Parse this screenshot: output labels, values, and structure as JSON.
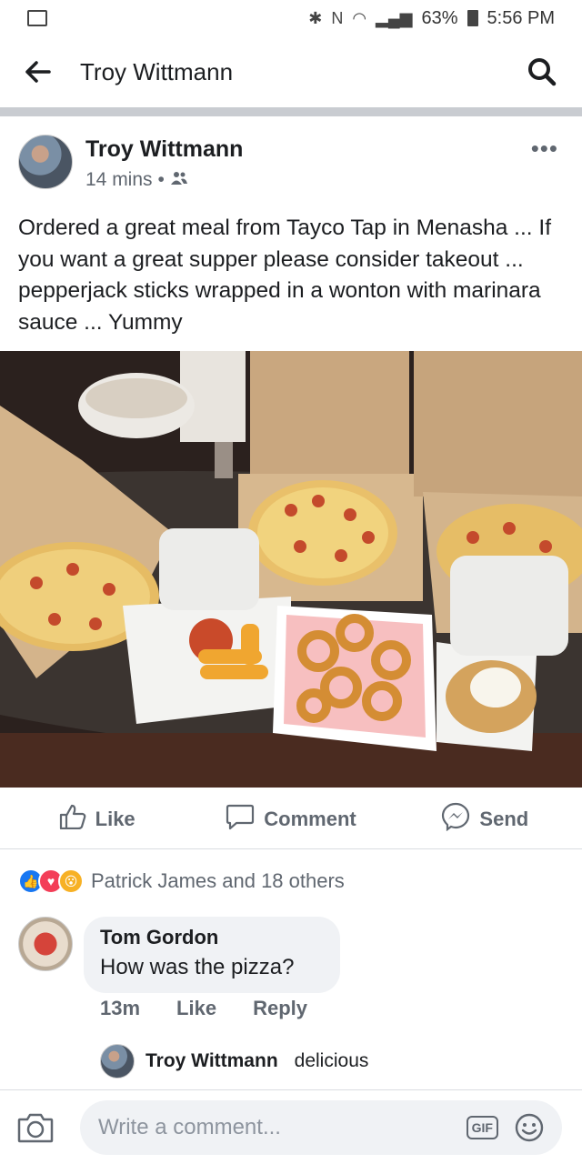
{
  "status_bar": {
    "battery": "63%",
    "time": "5:56 PM"
  },
  "header": {
    "title": "Troy Wittmann"
  },
  "post": {
    "author": "Troy Wittmann",
    "time": "14 mins",
    "text": "Ordered a great meal from Tayco Tap in Menasha ... If you want a great supper please consider takeout ... pepperjack sticks wrapped in a wonton with marinara sauce ... Yummy"
  },
  "actions": {
    "like": "Like",
    "comment": "Comment",
    "send": "Send"
  },
  "reactions": {
    "text": "Patrick James and 18 others"
  },
  "comment": {
    "author": "Tom Gordon",
    "text": "How was the pizza?",
    "time": "13m",
    "like": "Like",
    "reply": "Reply"
  },
  "reply": {
    "author": "Troy Wittmann",
    "text": "delicious"
  },
  "composer": {
    "placeholder": "Write a comment...",
    "gif": "GIF"
  },
  "colors": {
    "brand_blue": "#1877f2",
    "text": "#1c1e21",
    "secondary": "#606770"
  }
}
